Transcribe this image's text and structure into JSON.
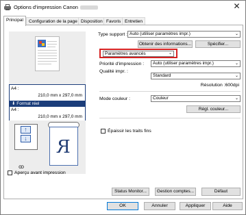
{
  "window": {
    "title": "Options d'impression Canon",
    "icon": "printer-icon",
    "close_glyph": "✕"
  },
  "tabs": [
    {
      "label": "Principal",
      "active": true
    },
    {
      "label": "Configuration de la page"
    },
    {
      "label": "Disposition"
    },
    {
      "label": "Favoris"
    },
    {
      "label": "Entretien"
    }
  ],
  "preview": {
    "input_size_label": "A4 :",
    "input_size_value": "210,0 mm x 297,0 mm",
    "format_label": "Format réel",
    "format_arrow": "⬇",
    "output_size_label": "A4 :",
    "output_size_value": "210,0 mm x 297,0 mm",
    "mirror_letter": "R",
    "glasses_glyph": "ꝏ"
  },
  "settings": {
    "media_type_label": "Type support :",
    "media_type_value": "Auto (utiliser paramètres impr.)",
    "get_info_button": "Obtenir des informations...",
    "specify_button": "Spécifier...",
    "advanced_value": "Paramètres avancés",
    "priority_label": "Priorité d'impression :",
    "priority_value": "Auto (utiliser paramètres impr.)",
    "quality_label": "Qualité impr. :",
    "quality_value": "Standard",
    "resolution_text": "Résolution :600dpi",
    "color_mode_label": "Mode couleur :",
    "color_mode_value": "Couleur",
    "color_adjust_button": "Régl. couleur...",
    "thicken_lines_label": "Épaissir les traits fins",
    "thicken_lines_checked": false,
    "preview_before_print_label": "Aperçu avant impression",
    "preview_before_print_checked": false
  },
  "panel_buttons": {
    "status_monitor": "Status Monitor...",
    "manage_options": "Gestion comptes...",
    "defaults": "Défaut"
  },
  "dialog_buttons": {
    "ok": "OK",
    "cancel": "Annuler",
    "apply": "Appliquer",
    "help": "Aide"
  },
  "colors": {
    "highlight_border": "#d62020",
    "selection_blue": "#1b3d7a",
    "default_button_border": "#0078d7"
  }
}
